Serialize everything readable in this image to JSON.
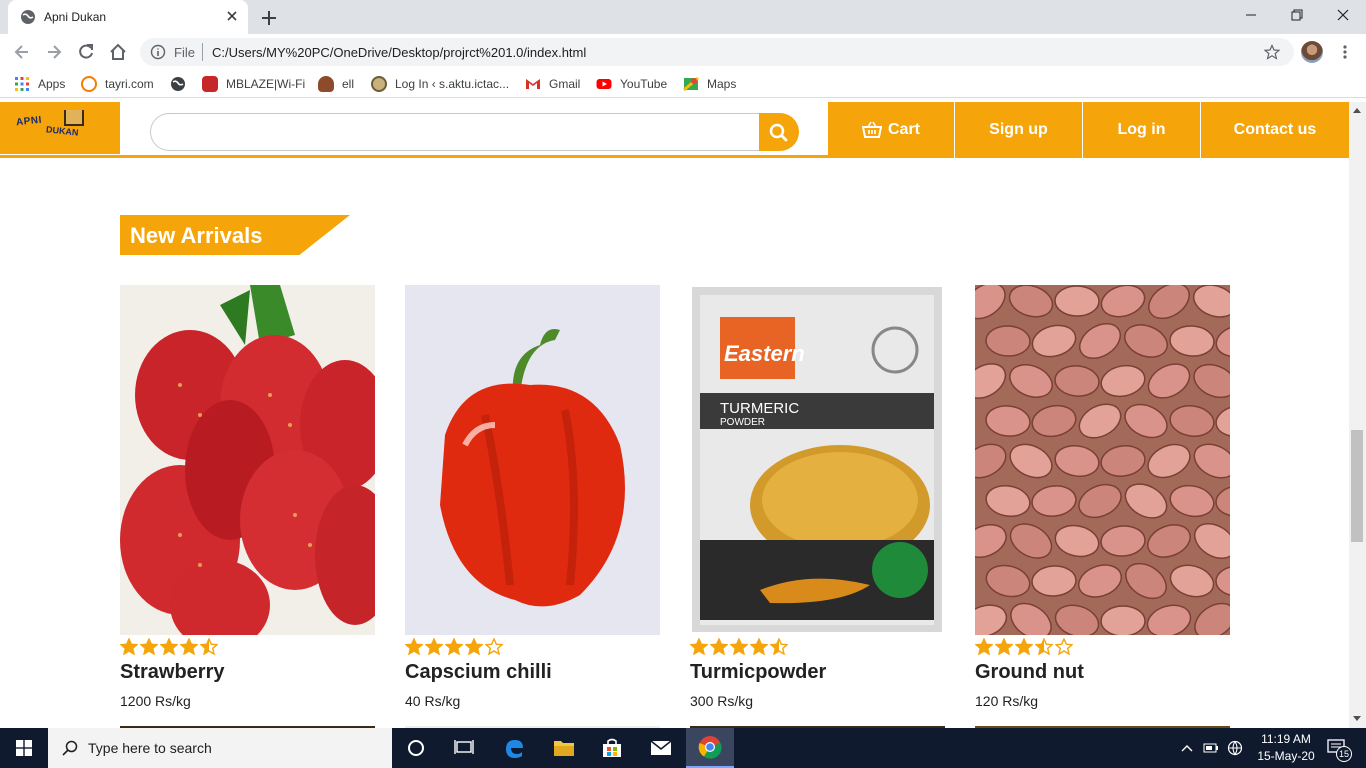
{
  "browser": {
    "tab_title": "Apni Dukan",
    "scheme_label": "File",
    "url": "C:/Users/MY%20PC/OneDrive/Desktop/projrct%201.0/index.html",
    "bookmarks": [
      {
        "label": "Apps",
        "icon": "apps-grid-icon",
        "color": "#4285f4"
      },
      {
        "label": "tayri.com",
        "icon": "tayri-icon",
        "color": "#f57c00"
      },
      {
        "label": "",
        "icon": "globe-icon",
        "color": "#3c4043"
      },
      {
        "label": "MBLAZE|Wi-Fi",
        "icon": "mblaze-icon",
        "color": "#c62828"
      },
      {
        "label": "ell",
        "icon": "ell-icon",
        "color": "#8d4b2b"
      },
      {
        "label": "Log In ‹ s.aktu.ictac...",
        "icon": "aktu-icon",
        "color": "#6d5c3a"
      },
      {
        "label": "Gmail",
        "icon": "gmail-icon",
        "color": "#d93025"
      },
      {
        "label": "YouTube",
        "icon": "youtube-icon",
        "color": "#ff0000"
      },
      {
        "label": "Maps",
        "icon": "maps-icon",
        "color": "#34a853"
      }
    ]
  },
  "site": {
    "logo_line1": "APNI",
    "logo_line2": "DUKAN",
    "search_placeholder": "",
    "nav": {
      "cart": "Cart",
      "signup": "Sign up",
      "login": "Log in",
      "contact": "Contact us"
    },
    "section_title": "New Arrivals",
    "accent": "#f5a50a",
    "products": [
      {
        "name": "Strawberry",
        "price": "1200 Rs/kg",
        "rating": 4.5
      },
      {
        "name": "Capscium chilli",
        "price": "40 Rs/kg",
        "rating": 4.0
      },
      {
        "name": "Turmicpowder",
        "price": "300 Rs/kg",
        "rating": 4.5
      },
      {
        "name": "Ground nut",
        "price": "120 Rs/kg",
        "rating": 3.5
      }
    ]
  },
  "taskbar": {
    "search_placeholder": "Type here to search",
    "time": "11:19 AM",
    "date": "15-May-20",
    "notifications": "15"
  }
}
